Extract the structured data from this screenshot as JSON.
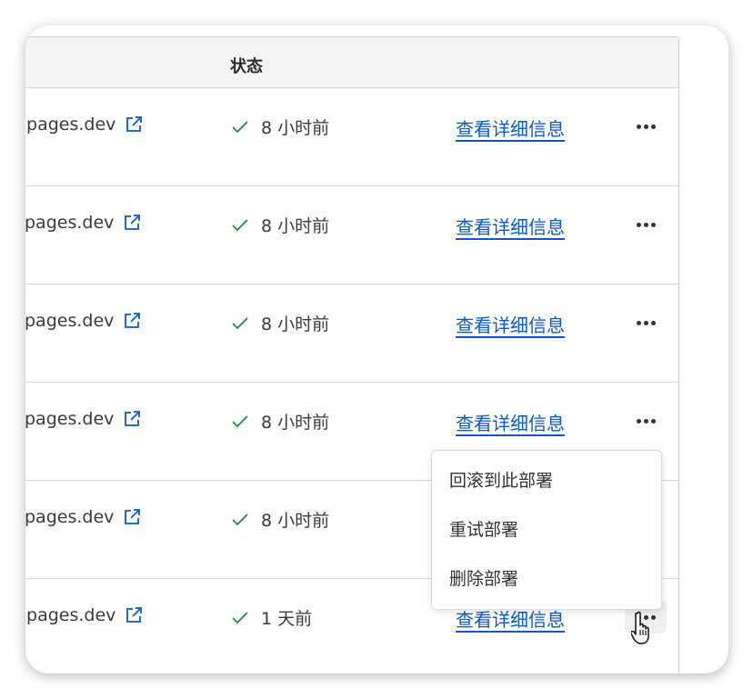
{
  "table": {
    "header": {
      "status": "状态"
    },
    "rows": [
      {
        "domain": ".pages.dev",
        "status": "8 小时前",
        "details": "查看详细信息"
      },
      {
        "domain": "pages.dev",
        "status": "8 小时前",
        "details": "查看详细信息"
      },
      {
        "domain": "pages.dev",
        "status": "8 小时前",
        "details": "查看详细信息"
      },
      {
        "domain": "pages.dev",
        "status": "8 小时前",
        "details": "查看详细信息"
      },
      {
        "domain": "pages.dev",
        "status": "8 小时前",
        "details": ""
      },
      {
        "domain": ".pages.dev",
        "status": "1 天前",
        "details": "查看详细信息"
      }
    ]
  },
  "menu": {
    "items": [
      "回滚到此部署",
      "重试部署",
      "删除部署"
    ]
  },
  "colors": {
    "link": "#0a58c9",
    "success": "#1f8a3b"
  }
}
